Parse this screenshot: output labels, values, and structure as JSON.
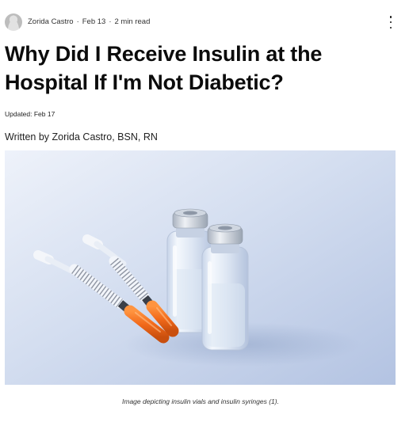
{
  "post_meta": {
    "author": "Zorida Castro",
    "separator": "·",
    "date": "Feb 13",
    "read_time": "2 min read",
    "more_icon": "more-vertical-icon"
  },
  "article": {
    "title": "Why Did I Receive Insulin at the Hospital If I'm Not Diabetic?",
    "updated": "Updated: Feb 17",
    "byline": "Written by Zorida Castro, BSN, RN",
    "image_caption": "Image depicting insulin vials and insulin syringes (1)."
  },
  "colors": {
    "syringe_cap": "#f26a1b",
    "background": "#ffffff",
    "title_text": "#0b0b0b"
  }
}
